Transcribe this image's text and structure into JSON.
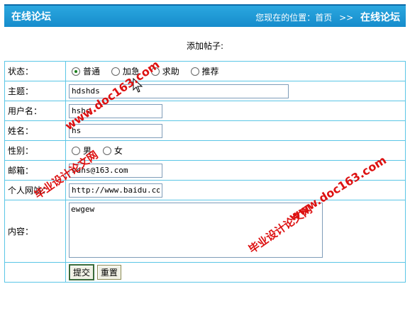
{
  "header": {
    "title": "在线论坛",
    "location_label": "您现在的位置：首页",
    "separator": ">>",
    "current": "在线论坛"
  },
  "subtitle": "添加帖子:",
  "form": {
    "status_label": "状态：",
    "status_options": [
      "普通",
      "加急",
      "求助",
      "推荐"
    ],
    "status_selected": "普通",
    "subject_label": "主题：",
    "subject_value": "hdshds",
    "username_label": "用户名：",
    "username_value": "hshs",
    "name_label": "姓名：",
    "name_value": "hs",
    "gender_label": "性别：",
    "gender_options": [
      "男",
      "女"
    ],
    "email_label": "邮箱：",
    "email_value": "sdhs@163.com",
    "website_label": "个人网站：",
    "website_value": "http://www.baidu.com",
    "content_label": "内容：",
    "content_value": "ewgew",
    "submit_label": "提交",
    "reset_label": "重置"
  },
  "watermarks": {
    "site": "www.doc163.com",
    "brand": "毕业设计论文网"
  }
}
